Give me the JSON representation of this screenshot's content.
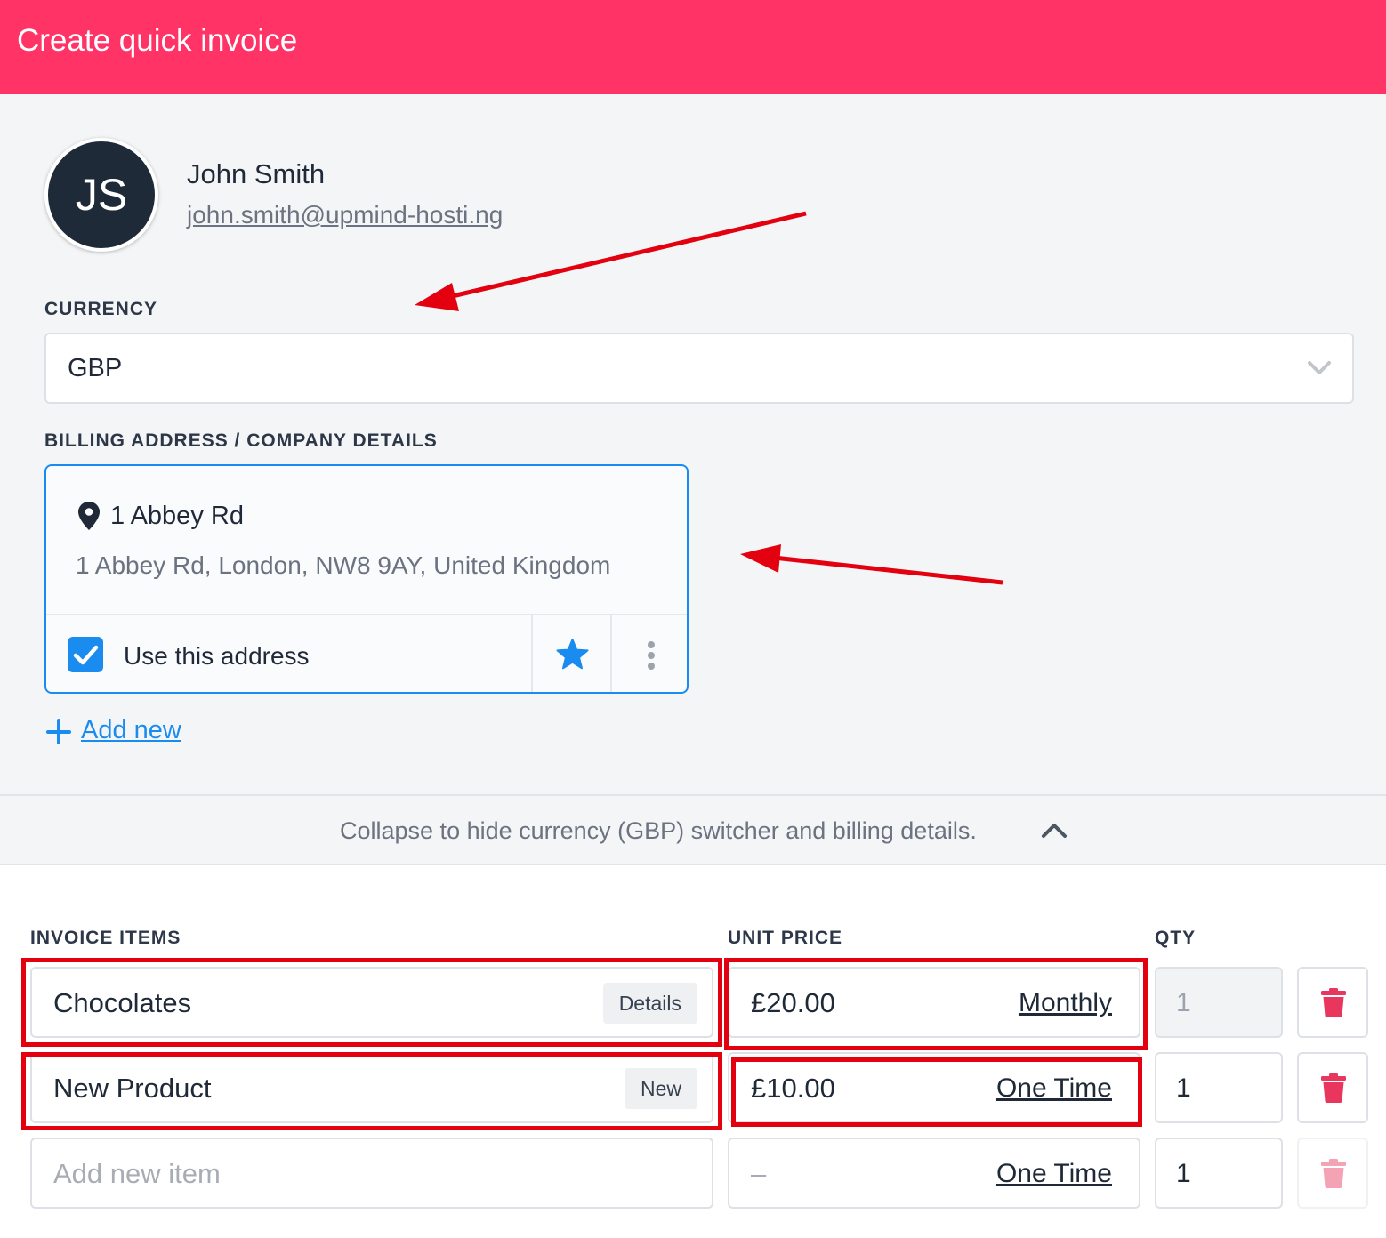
{
  "header": {
    "title": "Create quick invoice"
  },
  "user": {
    "initials": "JS",
    "name": "John Smith",
    "email": "john.smith@upmind-hosti.ng"
  },
  "currency": {
    "label": "CURRENCY",
    "value": "GBP"
  },
  "billing": {
    "label": "BILLING ADDRESS / COMPANY DETAILS",
    "address_title": "1 Abbey Rd",
    "address_line": "1 Abbey Rd, London, NW8 9AY, United Kingdom",
    "use_label": "Use this address",
    "use_checked": true,
    "add_new": "Add new"
  },
  "collapse": {
    "text": "Collapse to hide currency (GBP) switcher and billing details."
  },
  "items_table": {
    "headers": {
      "item": "INVOICE ITEMS",
      "price": "UNIT PRICE",
      "qty": "QTY"
    },
    "rows": [
      {
        "name": "Chocolates",
        "badge": "Details",
        "price": "£20.00",
        "recurrence": "Monthly",
        "qty": "1"
      },
      {
        "name": "New Product",
        "badge": "New",
        "price": "£10.00",
        "recurrence": "One Time",
        "qty": "1"
      },
      {
        "name_placeholder": "Add new item",
        "price": "–",
        "recurrence": "One Time",
        "qty": "1"
      }
    ]
  },
  "colors": {
    "brand": "#ff3366",
    "accent": "#1a8cf0",
    "danger": "#e8365d",
    "annotation": "#e3000f"
  }
}
